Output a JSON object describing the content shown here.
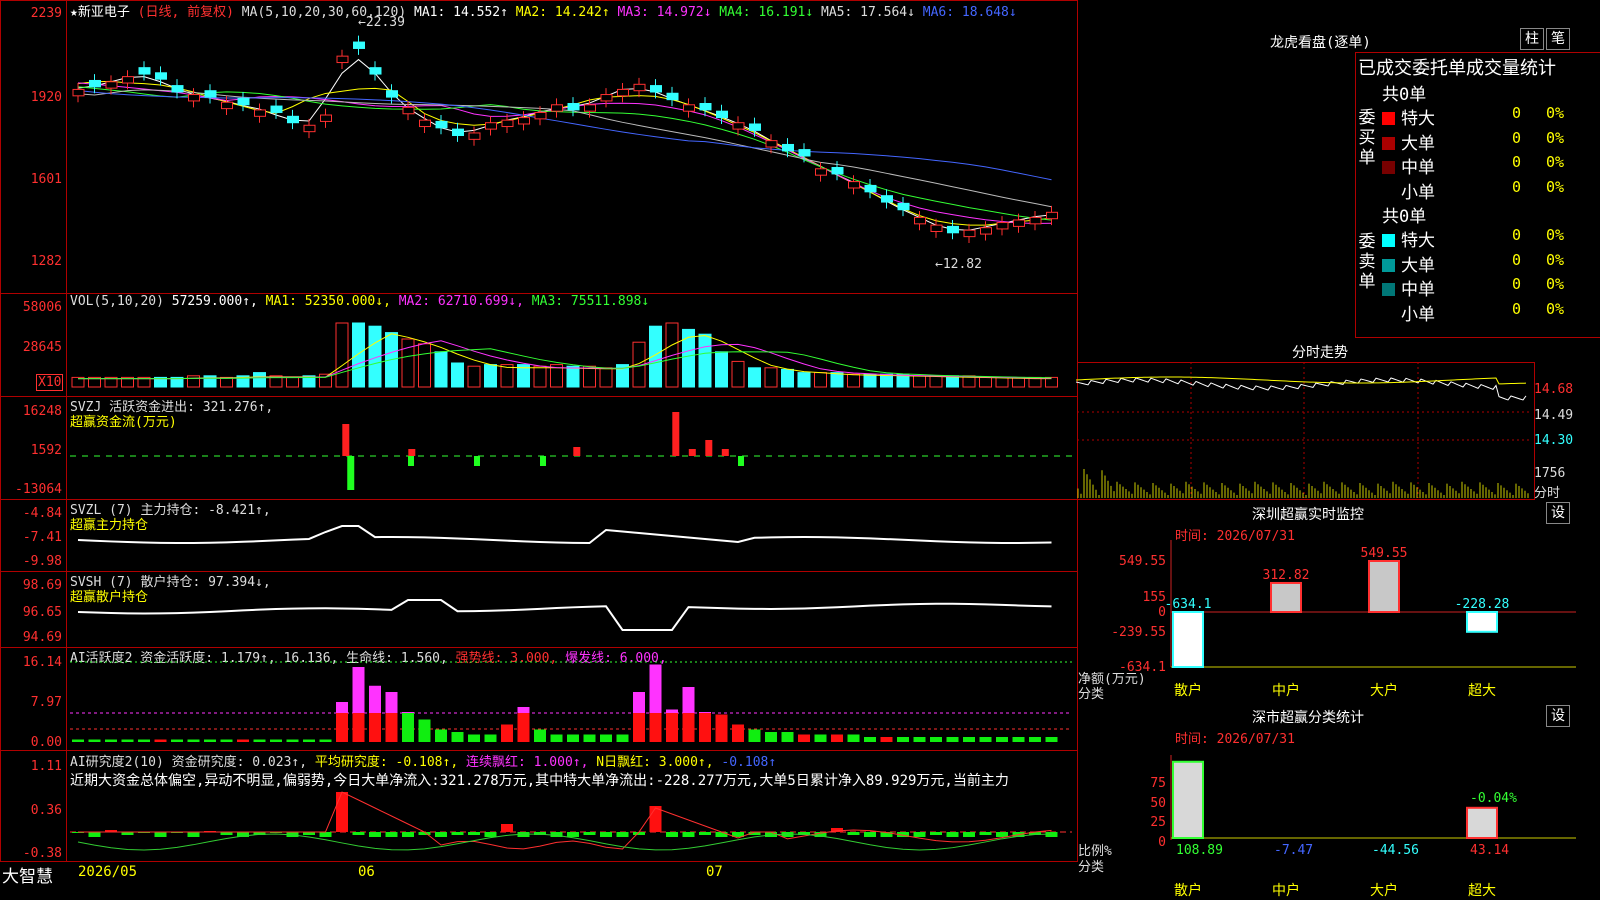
{
  "stock": {
    "name": "★新亚电子",
    "mode": "(日线, 前复权)"
  },
  "ma_line": {
    "label": "MA(5,10,20,30,60,120)",
    "items": [
      {
        "t": "MA1: 14.552↑",
        "c": "#ffffff"
      },
      {
        "t": "MA2: 14.242↑",
        "c": "#ffff00"
      },
      {
        "t": "MA3: 14.972↓",
        "c": "#ff33ff"
      },
      {
        "t": "MA4: 16.191↓",
        "c": "#33ff33"
      },
      {
        "t": "MA5: 17.564↓",
        "c": "#dddddd"
      },
      {
        "t": "MA6: 18.648↓",
        "c": "#4466ff"
      }
    ]
  },
  "price_axis": [
    "2239",
    "1920",
    "1601",
    "1282"
  ],
  "annot": {
    "high": "←22.39",
    "low": "←12.82"
  },
  "vol": {
    "head": "VOL(5,10,20)",
    "val": "57259.000↑,",
    "items": [
      {
        "t": "MA1: 52350.000↓,",
        "c": "#ffff00"
      },
      {
        "t": "MA2: 62710.699↓,",
        "c": "#ff33ff"
      },
      {
        "t": "MA3: 75511.898↓",
        "c": "#33ff33"
      }
    ],
    "axis": [
      "58006",
      "28645"
    ],
    "unit": "X10"
  },
  "svzj": {
    "head": "SVZJ  活跃资金进出: 321.276↑,",
    "sub": "超赢资金流(万元)",
    "axis": [
      "16248",
      "1592",
      "-13064"
    ]
  },
  "svzl": {
    "head": "SVZL  (7) 主力持仓: -8.421↑,",
    "sub": "超赢主力持仓",
    "axis": [
      "-4.84",
      "-7.41",
      "-9.98"
    ]
  },
  "svsh": {
    "head": "SVSH  (7) 散户持仓: 97.394↓,",
    "sub": "超赢散户持仓",
    "axis": [
      "98.69",
      "96.65",
      "94.69"
    ]
  },
  "ai1": {
    "head": "AI活跃度2 资金活跃度: 1.179↑, 16.136, 生命线: 1.560,",
    "strong": "强势线: 3.000,",
    "burst": "爆发线: 6.000,",
    "axis": [
      "16.14",
      "7.97",
      "0.00"
    ]
  },
  "ai2": {
    "head": "AI研究度2(10) 资金研究度: 0.023↑,",
    "avg": "平均研究度: -0.108↑,",
    "cont": "连续飘红: 1.000↑,",
    "nday": "N日飘红: 3.000↑,",
    "last": "-0.108↑",
    "text": "近期大资金总体偏空,异动不明显,偏弱势,今日大单净流入:321.278万元,其中特大单净流出:-228.277万元,大单5日累计净入89.929万元,当前主力",
    "axis": [
      "1.11",
      "0.36",
      "-0.38"
    ]
  },
  "dates": {
    "brand": "大智慧",
    "d1": "2026/05",
    "d2": "06",
    "d3": "07"
  },
  "lhb": {
    "title": "龙虎看盘(逐单)",
    "btn1": "柱",
    "btn2": "笔",
    "head": "已成交委托单成交量统计",
    "buy_label": "委买单",
    "sell_label": "委卖单",
    "count": "共0单",
    "buy": [
      {
        "n": "特大",
        "v": "0",
        "p": "0%",
        "c": "#ff0000"
      },
      {
        "n": "大单",
        "v": "0",
        "p": "0%",
        "c": "#aa0000"
      },
      {
        "n": "中单",
        "v": "0",
        "p": "0%",
        "c": "#770000"
      },
      {
        "n": "小单",
        "v": "0",
        "p": "0%",
        "c": "#000000"
      }
    ],
    "sell": [
      {
        "n": "特大",
        "v": "0",
        "p": "0%",
        "c": "#00ffff"
      },
      {
        "n": "大单",
        "v": "0",
        "p": "0%",
        "c": "#009999"
      },
      {
        "n": "中单",
        "v": "0",
        "p": "0%",
        "c": "#007777"
      },
      {
        "n": "小单",
        "v": "0",
        "p": "0%",
        "c": "#000000"
      }
    ]
  },
  "intraday": {
    "title": "分时走势",
    "axis": [
      "14.68",
      "14.49",
      "14.30"
    ],
    "vol_axis": [
      "1756",
      "分时"
    ]
  },
  "sz_monitor": {
    "title": "深圳超赢实时监控",
    "btn": "设",
    "time": "时间: 2026/07/31",
    "axis": [
      "549.55",
      "155",
      "0",
      "-239.55",
      "-634.1"
    ],
    "ylab": "净额(万元)",
    "xlab": "分类",
    "cats": [
      "散户",
      "中户",
      "大户",
      "超大"
    ],
    "values": [
      -634.1,
      312.82,
      549.55,
      -228.28
    ],
    "vlabels": [
      "-634.1",
      "312.82",
      "549.55",
      "-228.28"
    ]
  },
  "sz_class": {
    "title": "深市超赢分类统计",
    "btn": "设",
    "time": "时间: 2026/07/31",
    "axis": [
      "75",
      "50",
      "25",
      "0"
    ],
    "ylab": "比例%",
    "xlab": "分类",
    "cats": [
      "散户",
      "中户",
      "大户",
      "超大"
    ],
    "values": [
      108.89,
      -7.47,
      -44.56,
      43.14
    ],
    "pct": "-0.04%"
  },
  "chart_data": {
    "type": "bar",
    "title": "深圳超赢实时监控",
    "categories": [
      "散户",
      "中户",
      "大户",
      "超大"
    ],
    "values": [
      -634.1,
      312.82,
      549.55,
      -228.28
    ],
    "ylabel": "净额(万元)",
    "ylim": [
      -634.1,
      549.55
    ]
  }
}
